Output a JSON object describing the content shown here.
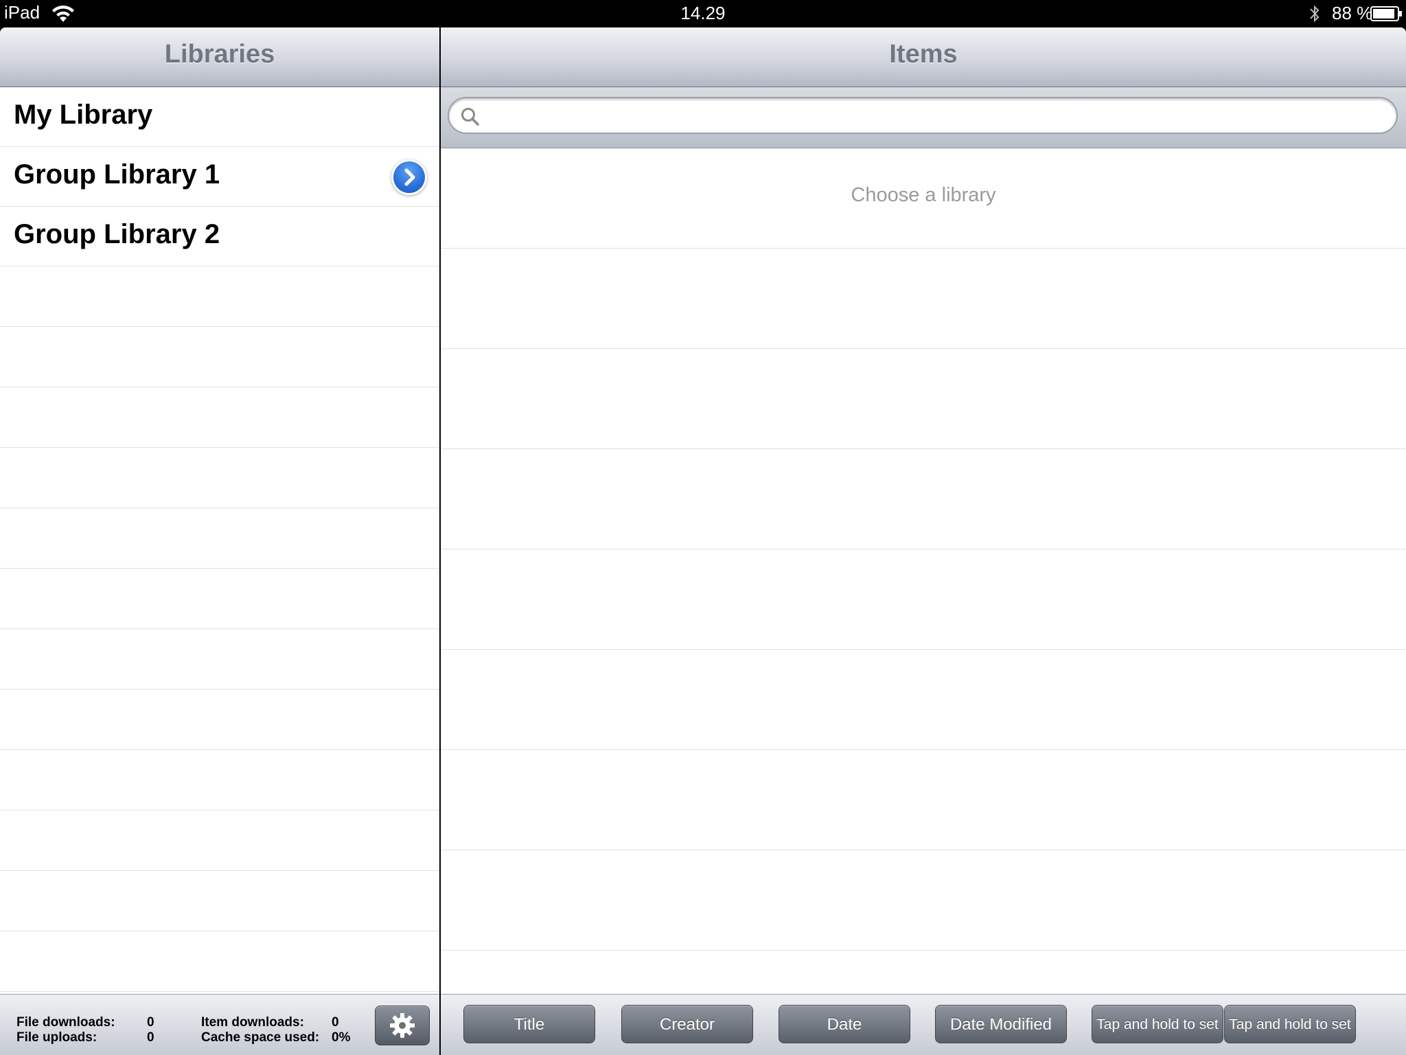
{
  "status_bar": {
    "device": "iPad",
    "time": "14.29",
    "battery": "88 %"
  },
  "libraries_pane": {
    "title": "Libraries",
    "items": [
      {
        "label": "My Library"
      },
      {
        "label": "Group Library 1"
      },
      {
        "label": "Group Library 2"
      }
    ],
    "stats": {
      "file_downloads_label": "File downloads:",
      "file_downloads_value": "0",
      "file_uploads_label": "File uploads:",
      "file_uploads_value": "0",
      "item_downloads_label": "Item downloads:",
      "item_downloads_value": "0",
      "cache_label": "Cache space used:",
      "cache_value": "0%"
    }
  },
  "items_pane": {
    "title": "Items",
    "search": {
      "value": "",
      "placeholder": ""
    },
    "empty_message": "Choose a library",
    "sort_buttons": [
      {
        "label": "Title"
      },
      {
        "label": "Creator"
      },
      {
        "label": "Date"
      },
      {
        "label": "Date Modified"
      },
      {
        "label": "Tap and hold to set"
      },
      {
        "label": "Tap and hold to set"
      }
    ]
  },
  "icons": {
    "wifi": "wifi-icon",
    "bluetooth": "bluetooth-icon",
    "battery": "battery-icon",
    "disclosure": "chevron-right-icon",
    "search": "search-icon",
    "settings": "gear-icon"
  }
}
